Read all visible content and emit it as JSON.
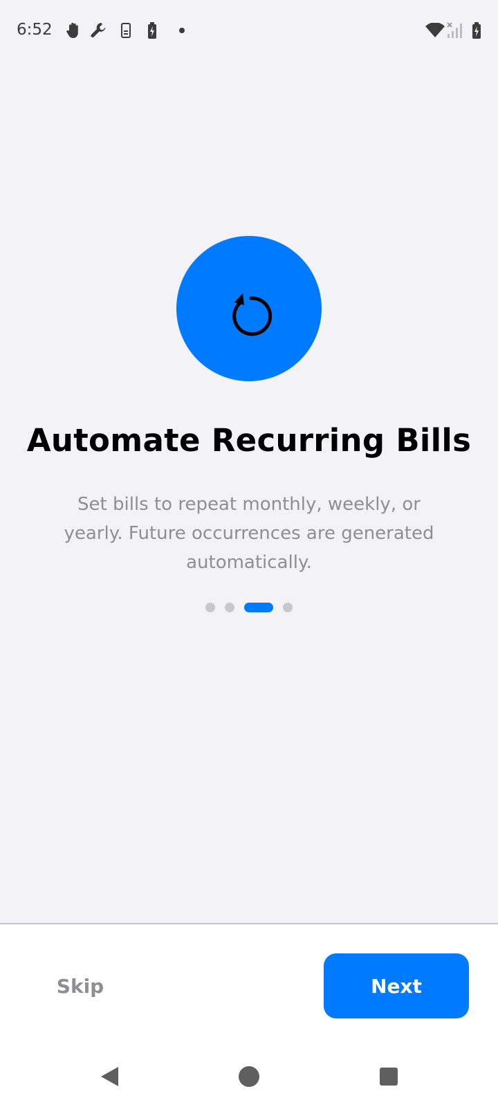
{
  "status_bar": {
    "time": "6:52",
    "left_icons": [
      "hand-icon",
      "wrench-icon",
      "phone-storage-icon",
      "battery-charging-icon",
      "dot-icon"
    ],
    "right_icons": [
      "wifi-icon",
      "cellular-no-signal-icon",
      "battery-icon"
    ]
  },
  "onboarding": {
    "hero_icon": "repeat-icon",
    "hero_color": "#007aff",
    "title": "Automate Recurring Bills",
    "description": "Set bills to repeat monthly, weekly, or yearly. Future occurrences are generated automatically.",
    "page_count": 4,
    "current_page": 3
  },
  "actions": {
    "skip_label": "Skip",
    "next_label": "Next",
    "accent": "#007aff"
  },
  "nav_bar": {
    "buttons": [
      "back-icon",
      "home-icon",
      "recents-icon"
    ]
  }
}
